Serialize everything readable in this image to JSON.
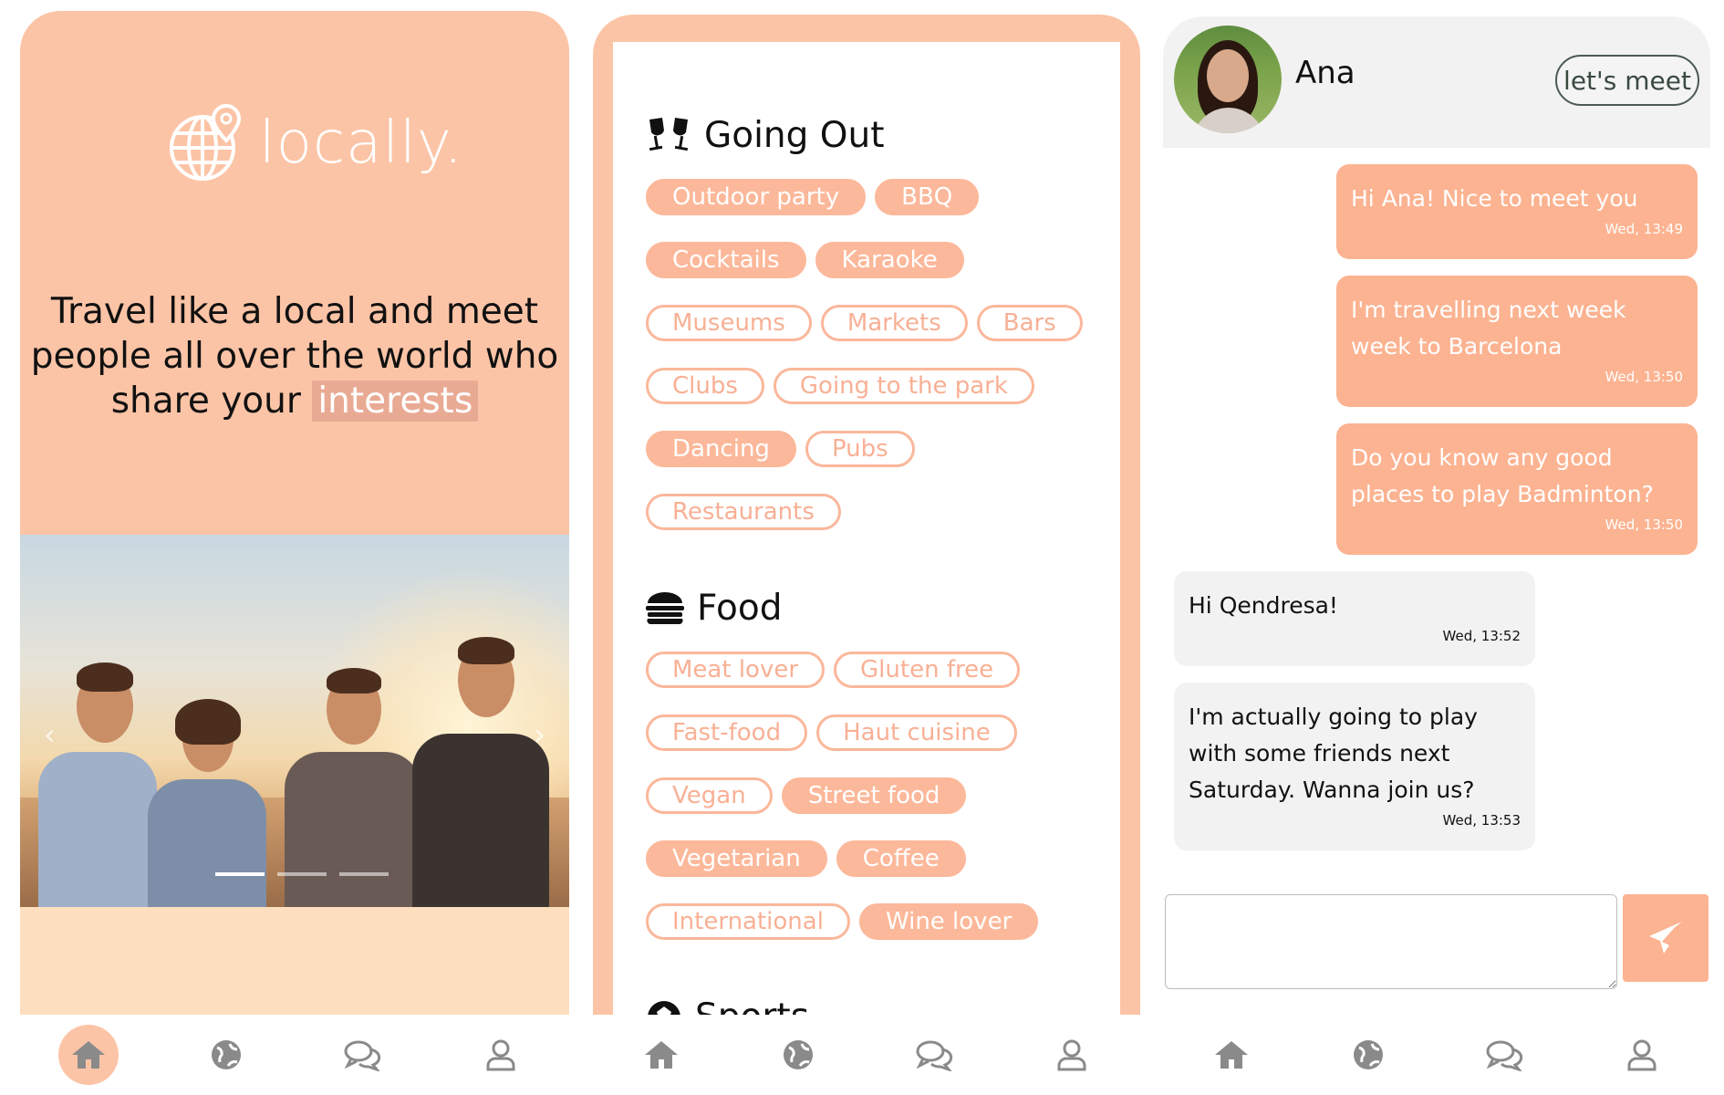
{
  "colors": {
    "primary": "#fcc4a6",
    "chip_selected": "#fcb89a",
    "chip_outline": "#fbb79b",
    "bubble_out": "#fcb391",
    "bubble_in": "#f2f2f2",
    "nav_icon": "#8a8a8a"
  },
  "welcome": {
    "logo_text": "locally.",
    "logo_icon": "globe-pin-icon",
    "tagline_main": "Travel like a local and meet people all over the world who share your",
    "tagline_highlight": "interests",
    "carousel": {
      "slides": 3,
      "active_slide": 1
    }
  },
  "interests": {
    "sections": [
      {
        "title": "Going Out",
        "icon": "cheers-icon",
        "rows": [
          [
            {
              "label": "Outdoor party",
              "selected": true
            },
            {
              "label": "BBQ",
              "selected": true
            }
          ],
          [
            {
              "label": "Cocktails",
              "selected": true
            },
            {
              "label": "Karaoke",
              "selected": true
            }
          ],
          [
            {
              "label": "Museums",
              "selected": false
            },
            {
              "label": "Markets",
              "selected": false
            },
            {
              "label": "Bars",
              "selected": false
            }
          ],
          [
            {
              "label": "Clubs",
              "selected": false
            },
            {
              "label": "Going to the park",
              "selected": false
            }
          ],
          [
            {
              "label": "Dancing",
              "selected": true
            },
            {
              "label": "Pubs",
              "selected": false
            }
          ],
          [
            {
              "label": "Restaurants",
              "selected": false
            }
          ]
        ]
      },
      {
        "title": "Food",
        "icon": "burger-icon",
        "rows": [
          [
            {
              "label": "Meat lover",
              "selected": false
            },
            {
              "label": "Gluten free",
              "selected": false
            }
          ],
          [
            {
              "label": "Fast-food",
              "selected": false
            },
            {
              "label": "Haut cuisine",
              "selected": false
            }
          ],
          [
            {
              "label": "Vegan",
              "selected": false
            },
            {
              "label": "Street food",
              "selected": true
            }
          ],
          [
            {
              "label": "Vegetarian",
              "selected": true
            },
            {
              "label": "Coffee",
              "selected": true
            }
          ],
          [
            {
              "label": "International",
              "selected": false
            },
            {
              "label": "Wine lover",
              "selected": true
            }
          ]
        ]
      }
    ],
    "next_section_peek": "Sports"
  },
  "chat": {
    "contact_name": "Ana",
    "meet_button": "let's meet",
    "messages": [
      {
        "dir": "out",
        "text": "Hi Ana! Nice to meet you",
        "time": "Wed, 13:49"
      },
      {
        "dir": "out",
        "text": "I'm travelling next week week to Barcelona",
        "time": "Wed, 13:50"
      },
      {
        "dir": "out",
        "text": "Do you know any good places to play Badminton?",
        "time": "Wed, 13:50"
      },
      {
        "dir": "in",
        "text": "Hi Qendresa!",
        "time": "Wed, 13:52"
      },
      {
        "dir": "in",
        "text": "I'm actually going to play with some friends next Saturday. Wanna join us?",
        "time": "Wed, 13:53"
      }
    ],
    "input_placeholder": "",
    "send_icon": "send-icon"
  },
  "nav": {
    "items": [
      "home-icon",
      "globe-icon",
      "chat-icon",
      "profile-icon"
    ]
  }
}
